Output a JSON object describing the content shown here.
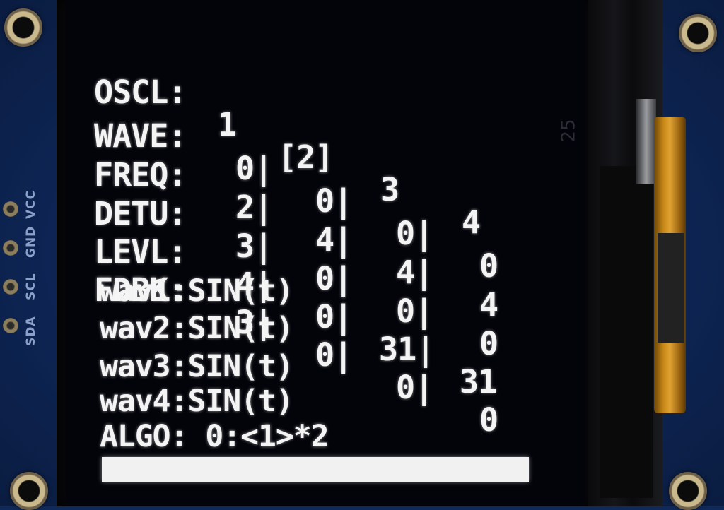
{
  "oled": {
    "header": {
      "label": "OSCL:",
      "cols": [
        "1",
        "[2]",
        "3",
        "4"
      ]
    },
    "rows": [
      {
        "label": "WAVE:",
        "cols": [
          "0|",
          "0|",
          "0|",
          "0"
        ]
      },
      {
        "label": "FREQ:",
        "cols": [
          "2|",
          "4|",
          "4|",
          "4"
        ]
      },
      {
        "label": "DETU:",
        "cols": [
          "3|",
          "0|",
          "0|",
          "0"
        ]
      },
      {
        "label": "LEVL:",
        "cols": [
          "4|",
          "0|",
          "31|",
          "31"
        ]
      },
      {
        "label": "FDBK:",
        "cols": [
          "3|",
          "0|",
          "0|",
          "0"
        ]
      }
    ],
    "waves": [
      "wav1:SIN(t)",
      "wav2:SIN(t)",
      "wav3:SIN(t)",
      "wav4:SIN(t)"
    ],
    "algo": "ALGO: 0:<1>*2",
    "progress_fraction": 1.0
  },
  "pcb": {
    "pins": [
      "SDA",
      "SCL",
      "GND",
      "VCC"
    ],
    "silkscreen": [
      "25"
    ]
  },
  "colors": {
    "pcb": "#0f2a5a",
    "screen_bg": "#02040a",
    "text": "#f4f4f4",
    "flex_cable": "#c98817"
  }
}
